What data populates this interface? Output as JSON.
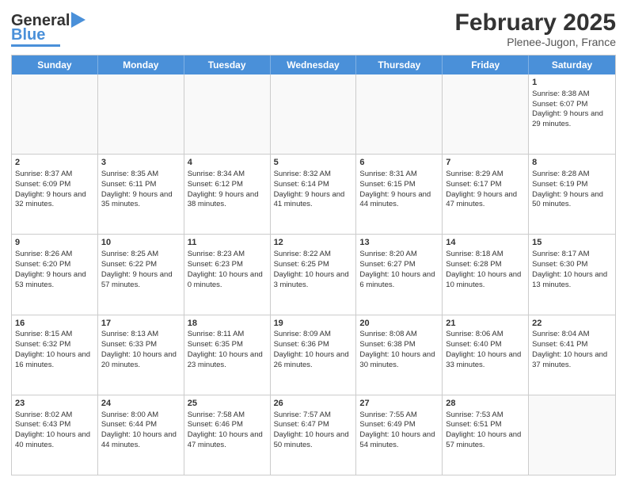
{
  "logo": {
    "line1": "General",
    "line2": "Blue"
  },
  "title": "February 2025",
  "subtitle": "Plenee-Jugon, France",
  "weekdays": [
    "Sunday",
    "Monday",
    "Tuesday",
    "Wednesday",
    "Thursday",
    "Friday",
    "Saturday"
  ],
  "weeks": [
    [
      {
        "day": "",
        "info": ""
      },
      {
        "day": "",
        "info": ""
      },
      {
        "day": "",
        "info": ""
      },
      {
        "day": "",
        "info": ""
      },
      {
        "day": "",
        "info": ""
      },
      {
        "day": "",
        "info": ""
      },
      {
        "day": "1",
        "info": "Sunrise: 8:38 AM\nSunset: 6:07 PM\nDaylight: 9 hours and 29 minutes."
      }
    ],
    [
      {
        "day": "2",
        "info": "Sunrise: 8:37 AM\nSunset: 6:09 PM\nDaylight: 9 hours and 32 minutes."
      },
      {
        "day": "3",
        "info": "Sunrise: 8:35 AM\nSunset: 6:11 PM\nDaylight: 9 hours and 35 minutes."
      },
      {
        "day": "4",
        "info": "Sunrise: 8:34 AM\nSunset: 6:12 PM\nDaylight: 9 hours and 38 minutes."
      },
      {
        "day": "5",
        "info": "Sunrise: 8:32 AM\nSunset: 6:14 PM\nDaylight: 9 hours and 41 minutes."
      },
      {
        "day": "6",
        "info": "Sunrise: 8:31 AM\nSunset: 6:15 PM\nDaylight: 9 hours and 44 minutes."
      },
      {
        "day": "7",
        "info": "Sunrise: 8:29 AM\nSunset: 6:17 PM\nDaylight: 9 hours and 47 minutes."
      },
      {
        "day": "8",
        "info": "Sunrise: 8:28 AM\nSunset: 6:19 PM\nDaylight: 9 hours and 50 minutes."
      }
    ],
    [
      {
        "day": "9",
        "info": "Sunrise: 8:26 AM\nSunset: 6:20 PM\nDaylight: 9 hours and 53 minutes."
      },
      {
        "day": "10",
        "info": "Sunrise: 8:25 AM\nSunset: 6:22 PM\nDaylight: 9 hours and 57 minutes."
      },
      {
        "day": "11",
        "info": "Sunrise: 8:23 AM\nSunset: 6:23 PM\nDaylight: 10 hours and 0 minutes."
      },
      {
        "day": "12",
        "info": "Sunrise: 8:22 AM\nSunset: 6:25 PM\nDaylight: 10 hours and 3 minutes."
      },
      {
        "day": "13",
        "info": "Sunrise: 8:20 AM\nSunset: 6:27 PM\nDaylight: 10 hours and 6 minutes."
      },
      {
        "day": "14",
        "info": "Sunrise: 8:18 AM\nSunset: 6:28 PM\nDaylight: 10 hours and 10 minutes."
      },
      {
        "day": "15",
        "info": "Sunrise: 8:17 AM\nSunset: 6:30 PM\nDaylight: 10 hours and 13 minutes."
      }
    ],
    [
      {
        "day": "16",
        "info": "Sunrise: 8:15 AM\nSunset: 6:32 PM\nDaylight: 10 hours and 16 minutes."
      },
      {
        "day": "17",
        "info": "Sunrise: 8:13 AM\nSunset: 6:33 PM\nDaylight: 10 hours and 20 minutes."
      },
      {
        "day": "18",
        "info": "Sunrise: 8:11 AM\nSunset: 6:35 PM\nDaylight: 10 hours and 23 minutes."
      },
      {
        "day": "19",
        "info": "Sunrise: 8:09 AM\nSunset: 6:36 PM\nDaylight: 10 hours and 26 minutes."
      },
      {
        "day": "20",
        "info": "Sunrise: 8:08 AM\nSunset: 6:38 PM\nDaylight: 10 hours and 30 minutes."
      },
      {
        "day": "21",
        "info": "Sunrise: 8:06 AM\nSunset: 6:40 PM\nDaylight: 10 hours and 33 minutes."
      },
      {
        "day": "22",
        "info": "Sunrise: 8:04 AM\nSunset: 6:41 PM\nDaylight: 10 hours and 37 minutes."
      }
    ],
    [
      {
        "day": "23",
        "info": "Sunrise: 8:02 AM\nSunset: 6:43 PM\nDaylight: 10 hours and 40 minutes."
      },
      {
        "day": "24",
        "info": "Sunrise: 8:00 AM\nSunset: 6:44 PM\nDaylight: 10 hours and 44 minutes."
      },
      {
        "day": "25",
        "info": "Sunrise: 7:58 AM\nSunset: 6:46 PM\nDaylight: 10 hours and 47 minutes."
      },
      {
        "day": "26",
        "info": "Sunrise: 7:57 AM\nSunset: 6:47 PM\nDaylight: 10 hours and 50 minutes."
      },
      {
        "day": "27",
        "info": "Sunrise: 7:55 AM\nSunset: 6:49 PM\nDaylight: 10 hours and 54 minutes."
      },
      {
        "day": "28",
        "info": "Sunrise: 7:53 AM\nSunset: 6:51 PM\nDaylight: 10 hours and 57 minutes."
      },
      {
        "day": "",
        "info": ""
      }
    ]
  ]
}
